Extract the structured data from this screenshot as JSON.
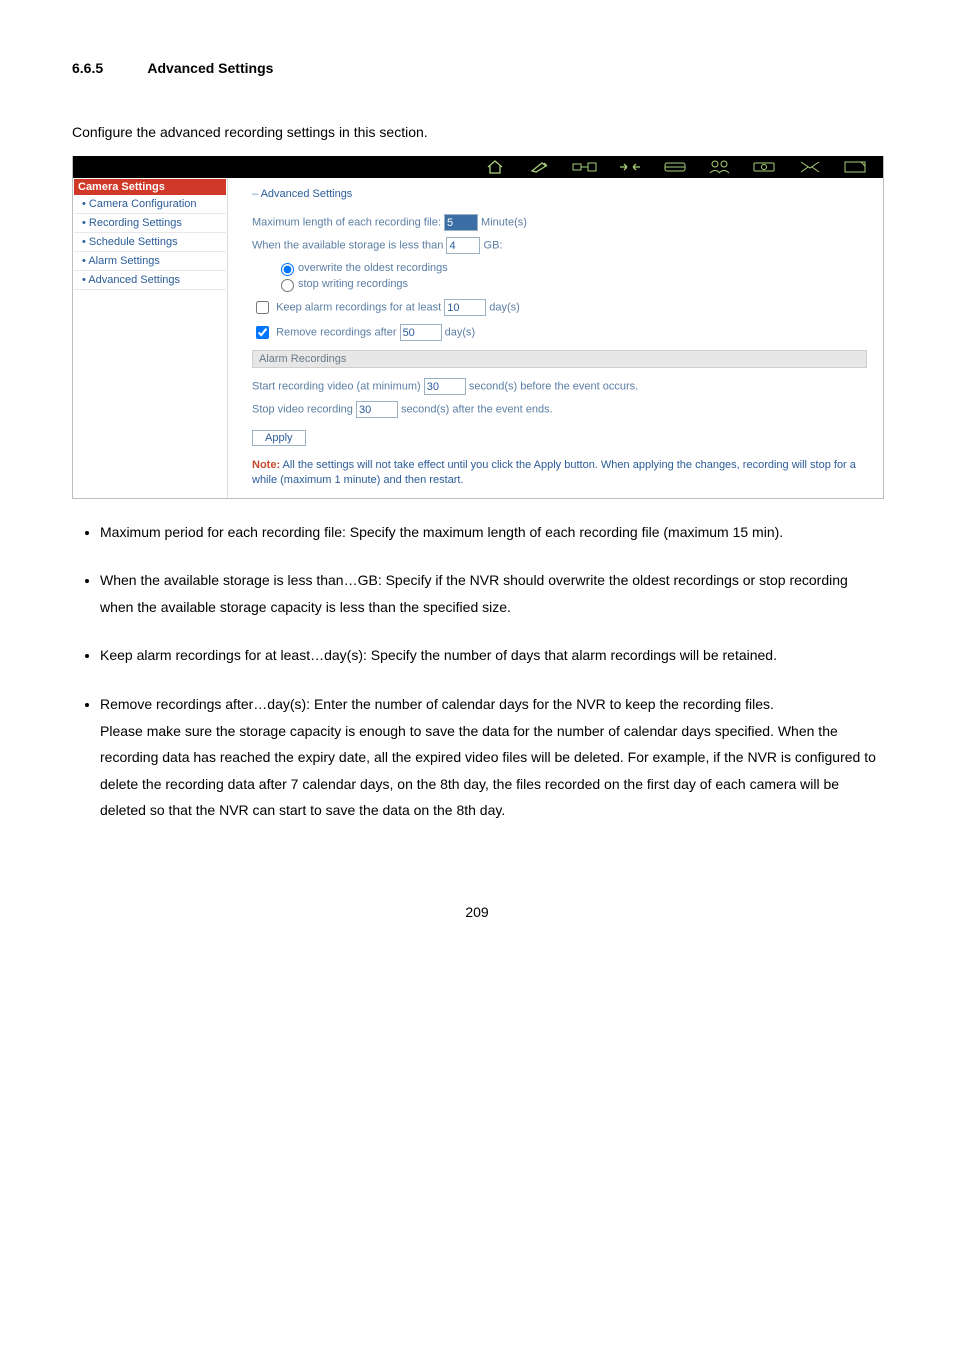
{
  "heading": {
    "number": "6.6.5",
    "title": "Advanced Settings"
  },
  "intro": "Configure the advanced recording settings in this section.",
  "screenshot": {
    "sidebar": {
      "header": "Camera Settings",
      "items": [
        "Camera Configuration",
        "Recording Settings",
        "Schedule Settings",
        "Alarm Settings",
        "Advanced Settings"
      ]
    },
    "panel": {
      "title": "Advanced Settings",
      "max_len_label_pre": "Maximum length of each recording file: ",
      "max_len_value": "5",
      "max_len_unit": " Minute(s)",
      "storage_label_pre": "When the available storage is less than ",
      "storage_value": "4",
      "storage_unit": " GB:",
      "radio1": "overwrite the oldest recordings",
      "radio2": "stop writing recordings",
      "keep_label_pre": "Keep alarm recordings for at least ",
      "keep_value": "10",
      "keep_unit": " day(s)",
      "remove_label_pre": "Remove recordings after ",
      "remove_value": "50",
      "remove_unit": " day(s)",
      "alarm_header": "Alarm Recordings",
      "start_label_pre": "Start recording video (at minimum) ",
      "start_value": "30",
      "start_unit": " second(s) before the event occurs.",
      "stop_label_pre": "Stop video recording ",
      "stop_value": "30",
      "stop_unit": " second(s) after the event ends.",
      "apply": "Apply",
      "note_bold": "Note:",
      "note_rest": " All the settings will not take effect until you click the Apply button. When applying the changes, recording will stop for a while (maximum 1 minute) and then restart."
    }
  },
  "bullets": {
    "b1": "Maximum period for each recording file: Specify the maximum length of each recording file (maximum 15 min).",
    "b2": "When the available storage is less than…GB: Specify if the NVR should overwrite the oldest recordings or stop recording when the available storage capacity is less than the specified size.",
    "b3": "Keep alarm recordings for at least…day(s): Specify the number of days that alarm recordings will be retained.",
    "b4a": "Remove recordings after…day(s): Enter the number of calendar days for the NVR to keep the recording files.",
    "b4b": "Please make sure the storage capacity is enough to save the data for the number of calendar days specified.   When the recording data has reached the expiry date, all the expired video files will be deleted.   For example, if the NVR is configured to delete the recording data after 7 calendar days, on the 8th day, the files recorded on the first day of each camera will be deleted so that the NVR can start to save the data on the 8th day."
  },
  "page_number": "209"
}
